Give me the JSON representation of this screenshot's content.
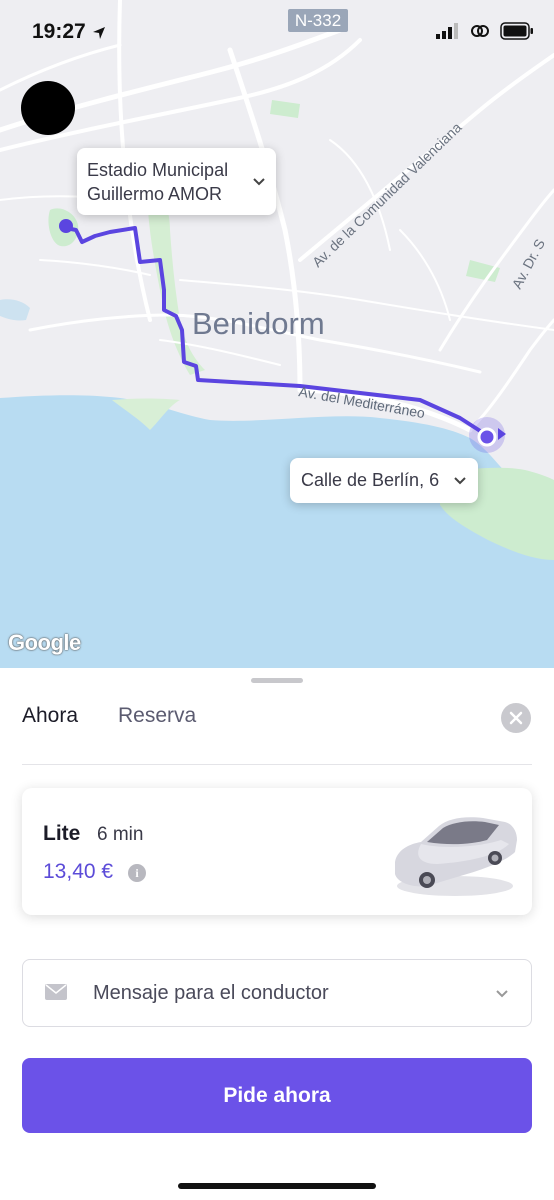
{
  "status_bar": {
    "time": "19:27"
  },
  "map": {
    "road_badge": "N-332",
    "city_label": "Benidorm",
    "street_labels": {
      "comunidad": "Av. de la Comunidad Valenciana",
      "mediterraneo": "Av. del Mediterráneo",
      "dr": "Av. Dr. S"
    },
    "origin_callout": {
      "line1": "Estadio Municipal",
      "line2": "Guillermo AMOR"
    },
    "destination_callout": "Calle de Berlín, 6",
    "attribution": "Google",
    "colors": {
      "route": "#5b45e0",
      "water": "#b8dcf2",
      "land": "#eeeef2",
      "park": "#cdeccf"
    }
  },
  "sheet": {
    "tabs": [
      {
        "label": "Ahora"
      },
      {
        "label": "Reserva"
      }
    ],
    "ride": {
      "name": "Lite",
      "eta": "6 min",
      "price": "13,40 €"
    },
    "message_placeholder": "Mensaje para el conductor",
    "cta_label": "Pide ahora",
    "colors": {
      "accent": "#6b52e8",
      "price": "#5b4bd8"
    }
  },
  "icons": [
    "location-arrow-icon",
    "signal-icon",
    "link-icon",
    "battery-icon",
    "chevron-down-icon",
    "close-icon",
    "info-icon",
    "envelope-icon",
    "car-icon",
    "destination-pin-icon",
    "origin-dot-icon"
  ]
}
